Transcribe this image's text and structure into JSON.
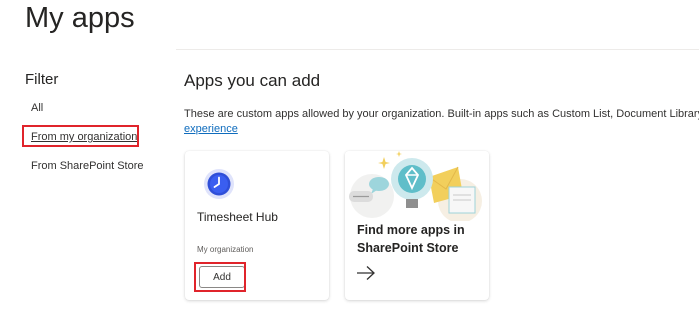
{
  "page": {
    "title": "My apps"
  },
  "filter": {
    "heading": "Filter",
    "items": [
      {
        "label": "All"
      },
      {
        "label": "From my organization"
      },
      {
        "label": "From SharePoint Store"
      }
    ]
  },
  "main": {
    "heading": "Apps you can add",
    "description": "These are custom apps allowed by your organization. Built-in apps such as Custom List, Document Library",
    "description_link": "experience",
    "app_card": {
      "name": "Timesheet Hub",
      "source": "My organization",
      "add_label": "Add",
      "icon": "clock-icon"
    },
    "store_card": {
      "text": "Find more apps in SharePoint Store",
      "arrow_icon": "arrow-right-icon"
    }
  },
  "colors": {
    "highlight": "#e0242b",
    "link": "#0f6cbd",
    "app_icon": "#2f4fd8"
  }
}
